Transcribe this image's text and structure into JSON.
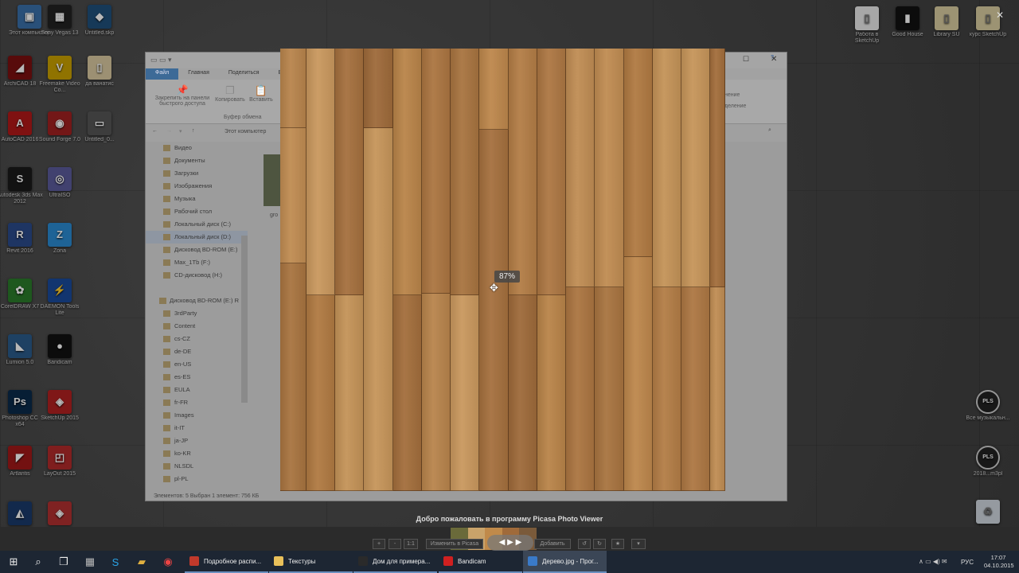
{
  "desktop": {
    "left_icons": [
      {
        "label": "Этот компьютер",
        "color": "#3a6fa8",
        "glyph": "▣"
      },
      {
        "label": "Sony Vegas 13",
        "color": "#222",
        "glyph": "▦"
      },
      {
        "label": "Untitled.skp",
        "color": "#1f4f7a",
        "glyph": "◆"
      },
      {
        "label": "ArchiCAD 18",
        "color": "#7a1010",
        "glyph": "◢"
      },
      {
        "label": "Freemake Video Co...",
        "color": "#c8a000",
        "glyph": "V"
      },
      {
        "label": "да ванатис",
        "color": "#d8c8a0",
        "glyph": "▯"
      },
      {
        "label": "AutoCAD 2016",
        "color": "#b01818",
        "glyph": "A"
      },
      {
        "label": "Sound Forge 7.0",
        "color": "#a02020",
        "glyph": "◉"
      },
      {
        "label": "Untitled_0...",
        "color": "#555",
        "glyph": "▭"
      },
      {
        "label": "Autodesk 3ds Max 2012",
        "color": "#1a1a1a",
        "glyph": "S"
      },
      {
        "label": "UltraISO",
        "color": "#5a5a9a",
        "glyph": "◎"
      },
      {
        "label": "Revit 2016",
        "color": "#2a4a8a",
        "glyph": "R"
      },
      {
        "label": "Zona",
        "color": "#2a8ad0",
        "glyph": "Z"
      },
      {
        "label": "CorelDRAW X7",
        "color": "#2a7a2a",
        "glyph": "✿"
      },
      {
        "label": "DAEMON Tools Lite",
        "color": "#1a4a9a",
        "glyph": "⚡"
      },
      {
        "label": "Lumion 5.0",
        "color": "#2a5a8a",
        "glyph": "◣"
      },
      {
        "label": "Bandicam",
        "color": "#111",
        "glyph": "●"
      },
      {
        "label": "Photoshop CC x64",
        "color": "#0a2a4a",
        "glyph": "Ps"
      },
      {
        "label": "SketchUp 2015",
        "color": "#b02020",
        "glyph": "◈"
      },
      {
        "label": "Artlantis",
        "color": "#a01818",
        "glyph": "◤"
      },
      {
        "label": "LayOut 2015",
        "color": "#b02a2a",
        "glyph": "◰"
      },
      {
        "label": "",
        "color": "#1a3a6a",
        "glyph": "◭"
      },
      {
        "label": "",
        "color": "#b03030",
        "glyph": "◈"
      }
    ],
    "right_icons": [
      {
        "label": "Работа в SketchUp",
        "color": "#e8e8e8",
        "glyph": "▯"
      },
      {
        "label": "Good House",
        "color": "#111",
        "glyph": "▮"
      },
      {
        "label": "Library SU",
        "color": "#d8cca0",
        "glyph": "▯"
      },
      {
        "label": "курс SketchUp",
        "color": "#d8cca0",
        "glyph": "▯"
      },
      {
        "label": "Все музыкальн...",
        "color": "#222",
        "glyph": "PLS"
      },
      {
        "label": "2018...m3pl",
        "color": "#222",
        "glyph": "PLS"
      },
      {
        "label": "",
        "color": "#cfd6de",
        "glyph": "♻"
      }
    ]
  },
  "explorer": {
    "ribbon_tabs": [
      "Файл",
      "Главная",
      "Поделиться",
      "Вид"
    ],
    "ribbon_items": {
      "pin": "Закрепить на панели быстрого доступа",
      "copy": "Копировать",
      "paste": "Вставить",
      "group": "Буфер обмена",
      "right1": "нение",
      "right2": "деление"
    },
    "address": "Этот компьютер",
    "nav_items": [
      {
        "label": "Видео",
        "sel": false,
        "tree": false
      },
      {
        "label": "Документы",
        "sel": false,
        "tree": false
      },
      {
        "label": "Загрузки",
        "sel": false,
        "tree": false
      },
      {
        "label": "Изображения",
        "sel": false,
        "tree": false
      },
      {
        "label": "Музыка",
        "sel": false,
        "tree": false
      },
      {
        "label": "Рабочий стол",
        "sel": false,
        "tree": false
      },
      {
        "label": "Локальный диск (C:)",
        "sel": false,
        "tree": false
      },
      {
        "label": "Локальный диск (D:)",
        "sel": true,
        "tree": false
      },
      {
        "label": "Дисковод BD-ROM (E:)",
        "sel": false,
        "tree": false
      },
      {
        "label": "Max_1Tb (F:)",
        "sel": false,
        "tree": false
      },
      {
        "label": "CD-дисковод (H:)",
        "sel": false,
        "tree": false
      },
      {
        "label": "",
        "sel": false,
        "tree": false
      },
      {
        "label": "Дисковод BD-ROM (E:) R",
        "sel": false,
        "tree": true
      },
      {
        "label": "3rdParty",
        "sel": false,
        "tree": false
      },
      {
        "label": "Content",
        "sel": false,
        "tree": false
      },
      {
        "label": "cs-CZ",
        "sel": false,
        "tree": false
      },
      {
        "label": "de-DE",
        "sel": false,
        "tree": false
      },
      {
        "label": "en-US",
        "sel": false,
        "tree": false
      },
      {
        "label": "es-ES",
        "sel": false,
        "tree": false
      },
      {
        "label": "EULA",
        "sel": false,
        "tree": false
      },
      {
        "label": "fr-FR",
        "sel": false,
        "tree": false
      },
      {
        "label": "Images",
        "sel": false,
        "tree": false
      },
      {
        "label": "it-IT",
        "sel": false,
        "tree": false
      },
      {
        "label": "ja-JP",
        "sel": false,
        "tree": false
      },
      {
        "label": "ko-KR",
        "sel": false,
        "tree": false
      },
      {
        "label": "NLSDL",
        "sel": false,
        "tree": false
      },
      {
        "label": "pl-PL",
        "sel": false,
        "tree": false
      }
    ],
    "file_label": "gro",
    "status": "Элементов: 5      Выбран 1 элемент: 756 КБ"
  },
  "viewer": {
    "zoom": "87%",
    "welcome": "Добро пожаловать в программу Picasa Photo Viewer",
    "btn_plus": "+",
    "btn_minus": "-",
    "btn_11": "1:1",
    "btn_edit": "Изменить в Picasa",
    "btn_add": "Добавить",
    "btn_rot_l": "↺",
    "btn_rot_r": "↻",
    "btn_star": "★",
    "btn_more": "▾",
    "close": "✕"
  },
  "taskbar": {
    "start": "⊞",
    "search": "⌕",
    "taskview": "❐",
    "apps": [
      {
        "label": "Подробное распи...",
        "color": "#c0392b",
        "active": false
      },
      {
        "label": "Текстуры",
        "color": "#e8c05a",
        "active": false
      },
      {
        "label": "Дом для примера...",
        "color": "#2a2a2a",
        "active": false
      },
      {
        "label": "Bandicam",
        "color": "#d02020",
        "active": false
      },
      {
        "label": "Дерево.jpg - Прог...",
        "color": "#3a7ac8",
        "active": true
      }
    ],
    "lang": "РУС",
    "time": "17:07",
    "date": "04.10.2015",
    "tray": "∧  ▭  ◀)  ✉"
  }
}
